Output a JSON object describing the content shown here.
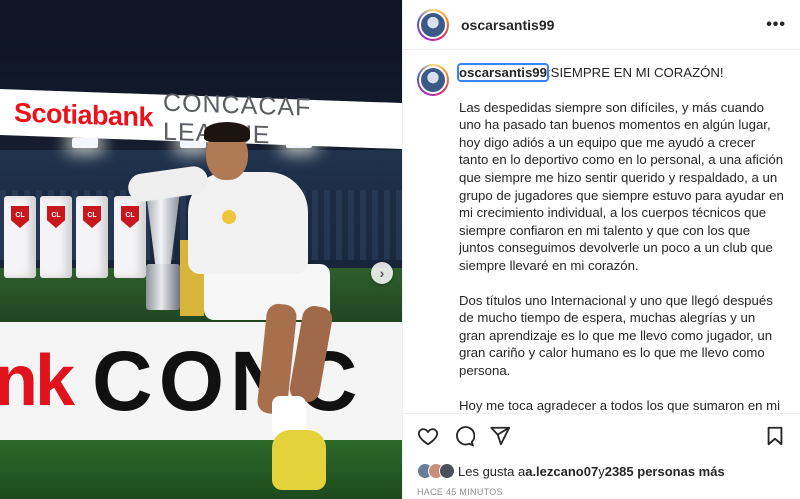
{
  "post": {
    "username": "oscarsantis99",
    "more_icon": "more-horizontal-icon",
    "photo": {
      "banner_top_brand": "Scotiabank",
      "banner_top_league": "CONCACAF LEAGUE",
      "banner_bottom_left": "nk",
      "banner_bottom_right": "CONC",
      "tube_logo": "CL",
      "next_icon": "chevron-right-icon"
    }
  },
  "caption": {
    "username": "oscarsantis99",
    "headline": ":SIEMPRE EN MI CORAZÓN!",
    "paragraphs": [
      "Las despedidas siempre son difíciles, y más cuando uno ha pasado tan buenos momentos en algún lugar, hoy digo adiós a un equipo que me ayudó a crecer tanto en lo deportivo como en lo personal, a una afición que siempre me hizo sentir querido y respaldado, a un grupo de jugadores que siempre estuvo para ayudar en mi crecimiento individual, a los cuerpos técnicos que siempre confiaron en mi talento y que con los que juntos conseguimos devolverle un poco a un club que siempre llevaré en mi corazón.",
      "Dos títulos uno Internacional y uno que llegó después de mucho tiempo de espera, muchas alegrías y un gran aprendizaje es lo que me llevo como jugador, un gran cariño y calor humano es lo que me llevo como persona.",
      "Hoy me toca agradecer a todos los que sumaron en mi estancia en Comunicaciones pero en la vida profesional siempre se debe buscar el crecimiento y los nuevos retos los cuales encarare con la misma ilusión que cuando niño soñaba cumplir."
    ]
  },
  "actions": {
    "like_icon": "heart-icon",
    "comment_icon": "comment-icon",
    "share_icon": "send-icon",
    "save_icon": "bookmark-icon"
  },
  "likes": {
    "prefix": "Les gusta a ",
    "first_user": "a.lezcano07",
    "middle": " y ",
    "others": "2385 personas más"
  },
  "timestamp": "HACE 45 MINUTOS",
  "colors": {
    "scotiabank_red": "#ec111a",
    "story_ring": "#d62976",
    "selection_outline": "#3b82f6"
  }
}
